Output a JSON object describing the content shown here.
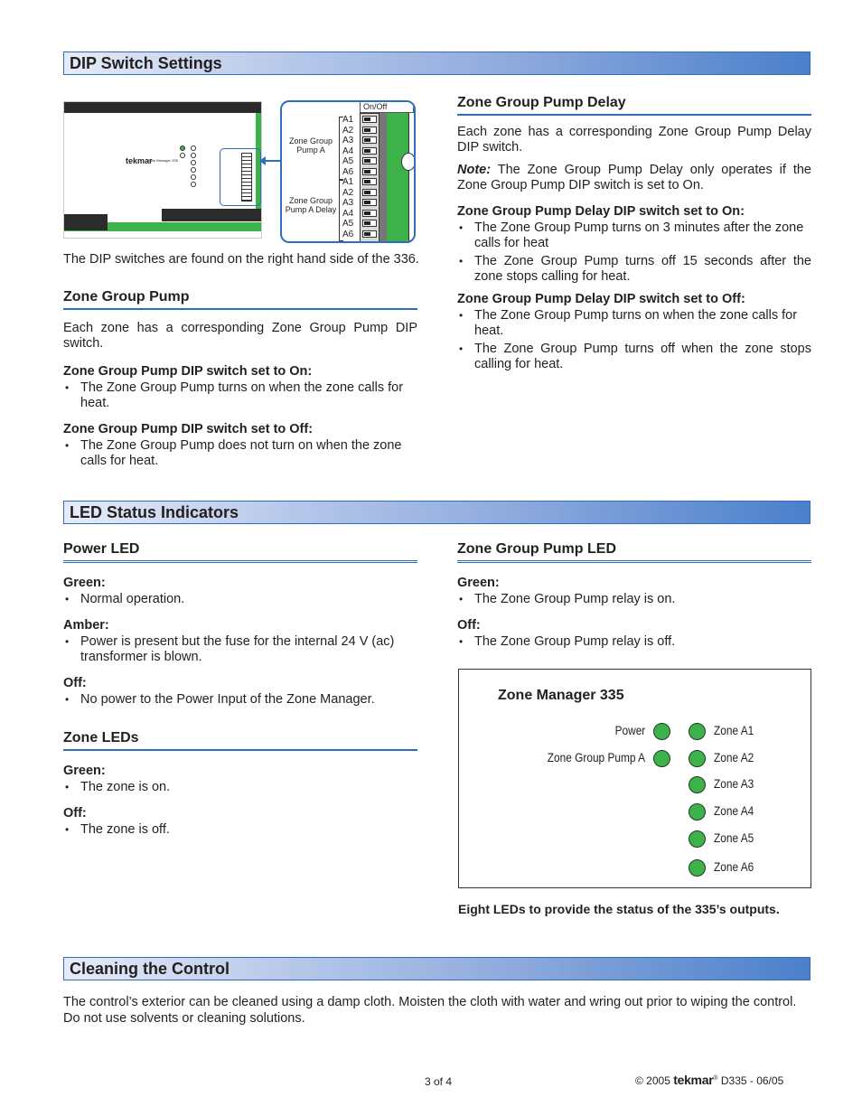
{
  "sections": {
    "dip": "DIP Switch Settings",
    "led": "LED Status Indicators",
    "cleaning": "Cleaning the Control"
  },
  "diagram": {
    "caption": "The DIP switches are found on the right hand side of the 336.",
    "brand": "tekmar",
    "model": "Zone Manager 335",
    "on_off_label": "On/Off",
    "group1_label": "Zone Group Pump A",
    "group2_label": "Zone Group Pump A Delay",
    "switches": [
      "A1",
      "A2",
      "A3",
      "A4",
      "A5",
      "A6",
      "A1",
      "A2",
      "A3",
      "A4",
      "A5",
      "A6"
    ],
    "mini_leds": [
      "Power",
      "Zone Group Pump A",
      "Zone A1",
      "Zone A2",
      "Zone A3",
      "Zone A4",
      "Zone A5",
      "Zone A6"
    ]
  },
  "zone_group_pump": {
    "heading": "Zone Group Pump",
    "intro": "Each zone has a corresponding Zone Group Pump DIP switch.",
    "on_label": "Zone Group Pump DIP switch set to On:",
    "on_items": [
      "The Zone Group Pump turns on when the zone calls for heat."
    ],
    "off_label": "Zone Group Pump DIP switch set to Off:",
    "off_items": [
      "The Zone Group Pump does not turn on when the zone calls for heat."
    ]
  },
  "zone_group_pump_delay": {
    "heading": "Zone Group Pump Delay",
    "intro": "Each zone has a corresponding Zone Group Pump Delay DIP switch.",
    "note_label": "Note:",
    "note_text": " The Zone Group Pump Delay only operates if the Zone Group Pump DIP switch is set to On.",
    "on_label": "Zone Group Pump Delay DIP switch set to On:",
    "on_items": [
      "The Zone Group Pump turns on 3 minutes after the zone calls for heat",
      "The Zone Group Pump turns off 15 seconds after the zone stops calling for heat."
    ],
    "off_label": "Zone Group Pump Delay DIP switch set to Off:",
    "off_items": [
      "The Zone Group Pump turns on when the zone calls for heat.",
      "The Zone Group Pump turns off when the zone stops calling for heat."
    ]
  },
  "power_led": {
    "heading": "Power LED",
    "green_label": "Green:",
    "green_items": [
      "Normal operation."
    ],
    "amber_label": "Amber:",
    "amber_items": [
      "Power is present but the fuse for the internal 24 V (ac) transformer is blown."
    ],
    "off_label": "Off:",
    "off_items": [
      "No power to the Power Input of the Zone Manager."
    ]
  },
  "zone_leds": {
    "heading": "Zone LEDs",
    "green_label": "Green:",
    "green_items": [
      "The zone is on."
    ],
    "off_label": "Off:",
    "off_items": [
      "The zone is off."
    ]
  },
  "zone_group_pump_led": {
    "heading": "Zone Group Pump LED",
    "green_label": "Green:",
    "green_items": [
      "The Zone Group Pump relay is on."
    ],
    "off_label": "Off:",
    "off_items": [
      "The Zone Group Pump relay is off."
    ]
  },
  "led_panel": {
    "title": "Zone Manager 335",
    "left": [
      "Power",
      "Zone Group Pump A"
    ],
    "right": [
      "Zone A1",
      "Zone A2",
      "Zone A3",
      "Zone A4",
      "Zone A5",
      "Zone A6"
    ],
    "led_color": "#3db14a",
    "caption": "Eight LEDs to provide the status of the 335’s outputs."
  },
  "cleaning": {
    "text": "The control’s exterior can be cleaned using a damp cloth. Moisten the cloth with water and wring out prior to wiping the control. Do not use solvents or cleaning solutions."
  },
  "footer": {
    "page": "3 of 4",
    "copyright": "© 2005",
    "brand": "tekmar",
    "reg": "®",
    "doc": "D335 - 06/05"
  },
  "colors": {
    "accent_blue": "#2c6fbd",
    "led_green": "#3db14a"
  }
}
